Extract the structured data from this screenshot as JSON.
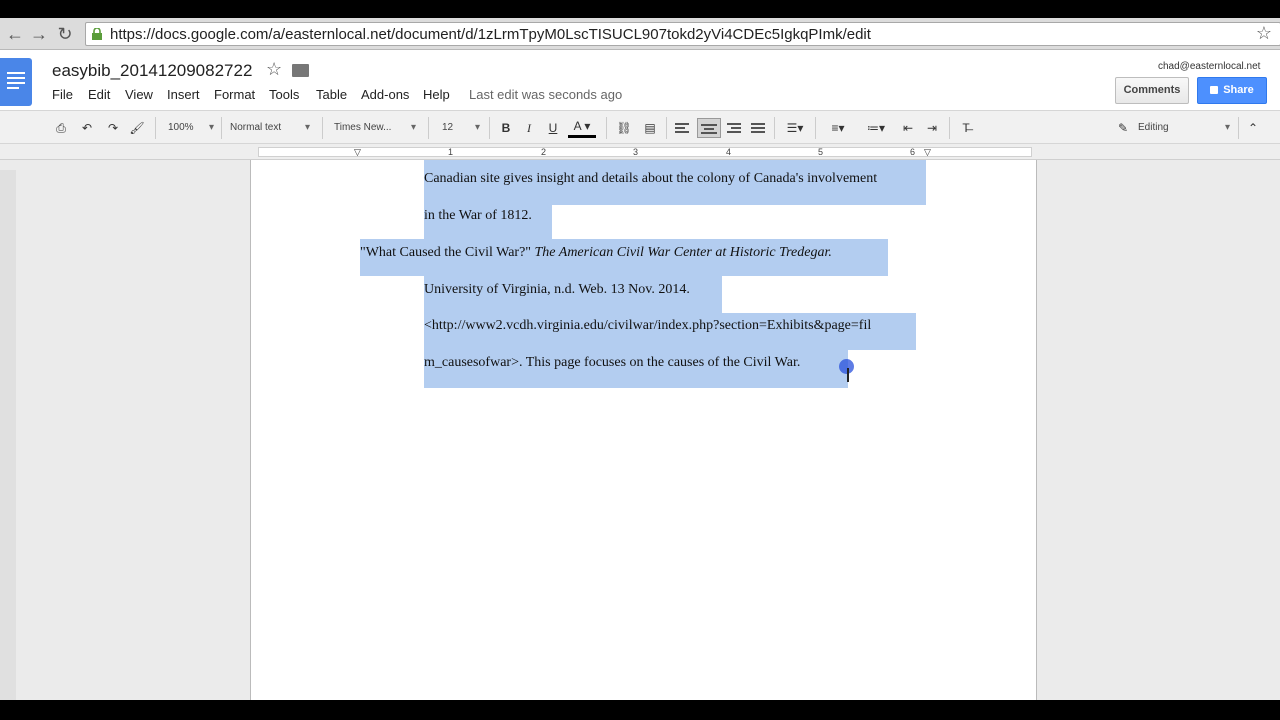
{
  "browser": {
    "url": "https://docs.google.com/a/easternlocal.net/document/d/1zLrmTpyM0LscTISUCL907tokd2yVi4CDEc5IgkqPImk/edit"
  },
  "doc": {
    "title": "easybib_20141209082722",
    "last_edit": "Last edit was seconds ago",
    "account": "chad@easternlocal.net",
    "comments_label": "Comments",
    "share_label": "Share"
  },
  "menu": [
    "File",
    "Edit",
    "View",
    "Insert",
    "Format",
    "Tools",
    "Table",
    "Add-ons",
    "Help"
  ],
  "toolbar": {
    "zoom": "100%",
    "style": "Normal text",
    "font": "Times New...",
    "size": "12",
    "mode": "Editing"
  },
  "ruler": [
    "1",
    "2",
    "3",
    "4",
    "5",
    "6"
  ],
  "content": {
    "line1": "Canadian site gives insight and details about the colony of Canada's involvement",
    "line2": "in the War of 1812.",
    "line3_title": "\"What Caused the Civil War?\"",
    "line3_source": "The American Civil War Center at Historic Tredegar.",
    "line4": "University of Virginia, n.d. Web. 13 Nov. 2014.",
    "line5": "<http://www2.vcdh.virginia.edu/civilwar/index.php?section=Exhibits&page=fil",
    "line6": "m_causesofwar>. This page focuses on the causes of the Civil War."
  },
  "colors": {
    "selection": "#b3cdf0",
    "share": "#4d90fe",
    "docs_blue": "#4a86e8"
  }
}
